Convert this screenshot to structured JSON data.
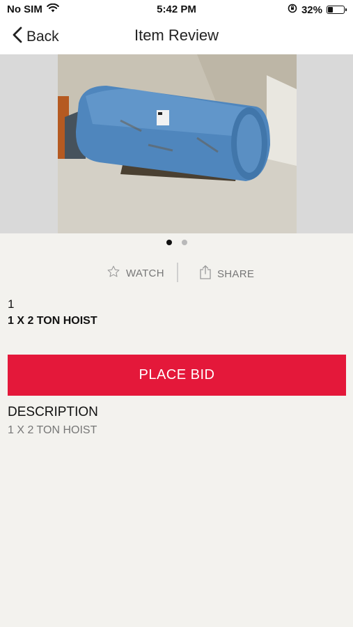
{
  "status_bar": {
    "carrier": "No SIM",
    "time": "5:42 PM",
    "battery_percent": "32%",
    "battery_level": 0.32
  },
  "nav": {
    "back_label": "Back",
    "title": "Item Review"
  },
  "gallery": {
    "page_count": 2,
    "active_page": 1
  },
  "actions": {
    "watch_label": "WATCH",
    "share_label": "SHARE"
  },
  "item": {
    "lot_number": "1",
    "title": "1 X 2 TON HOIST"
  },
  "bid_button": {
    "label": "PLACE BID",
    "color": "#e4183a"
  },
  "description": {
    "heading": "DESCRIPTION",
    "text": "1 X 2 TON HOIST"
  }
}
